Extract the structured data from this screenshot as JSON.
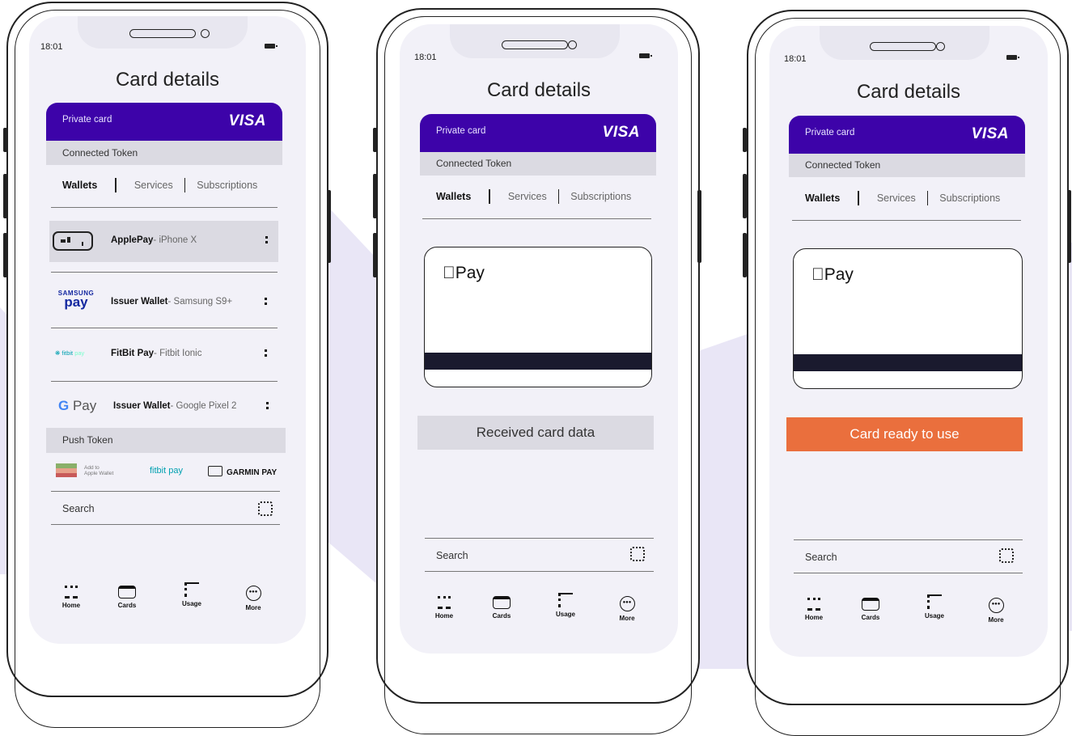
{
  "screens": [
    {
      "time": "18:01",
      "title": "Card details",
      "card_label": "Private card",
      "card_brand": "VISA",
      "connected_token": "Connected Token",
      "tabs": [
        "Wallets",
        "Services",
        "Subscriptions"
      ],
      "wallets": [
        {
          "logo": "ApplePay-icon",
          "name": "ApplePay",
          "device": " - iPhone X"
        },
        {
          "logo": "SAMSUNG pay",
          "name": "Issuer Wallet",
          "device": " - Samsung S9+"
        },
        {
          "logo": "fitbit pay",
          "name": "FitBit Pay",
          "device": " - Fitbit Ionic"
        },
        {
          "logo": "G Pay",
          "name": "Issuer Wallet",
          "device": " - Google Pixel 2"
        }
      ],
      "push_token": "Push Token",
      "push_targets": [
        "Add to Apple Wallet",
        "fitbit pay",
        "GARMIN PAY"
      ],
      "search": "Search",
      "nav": [
        "Home",
        "Cards",
        "Usage",
        "More"
      ]
    },
    {
      "time": "18:01",
      "title": "Card details",
      "card_label": "Private card",
      "card_brand": "VISA",
      "connected_token": "Connected Token",
      "tabs": [
        "Wallets",
        "Services",
        "Subscriptions"
      ],
      "pay_logo": "Pay",
      "status": "Received card data",
      "search": "Search",
      "nav": [
        "Home",
        "Cards",
        "Usage",
        "More"
      ]
    },
    {
      "time": "18:01",
      "title": "Card details",
      "card_label": "Private card",
      "card_brand": "VISA",
      "connected_token": "Connected Token",
      "tabs": [
        "Wallets",
        "Services",
        "Subscriptions"
      ],
      "pay_logo": "Pay",
      "status": "Card ready to use",
      "search": "Search",
      "nav": [
        "Home",
        "Cards",
        "Usage",
        "More"
      ]
    }
  ],
  "colors": {
    "accent": "#3d03a9",
    "ready": "#ea6f3d",
    "received": "#dbdae2"
  }
}
